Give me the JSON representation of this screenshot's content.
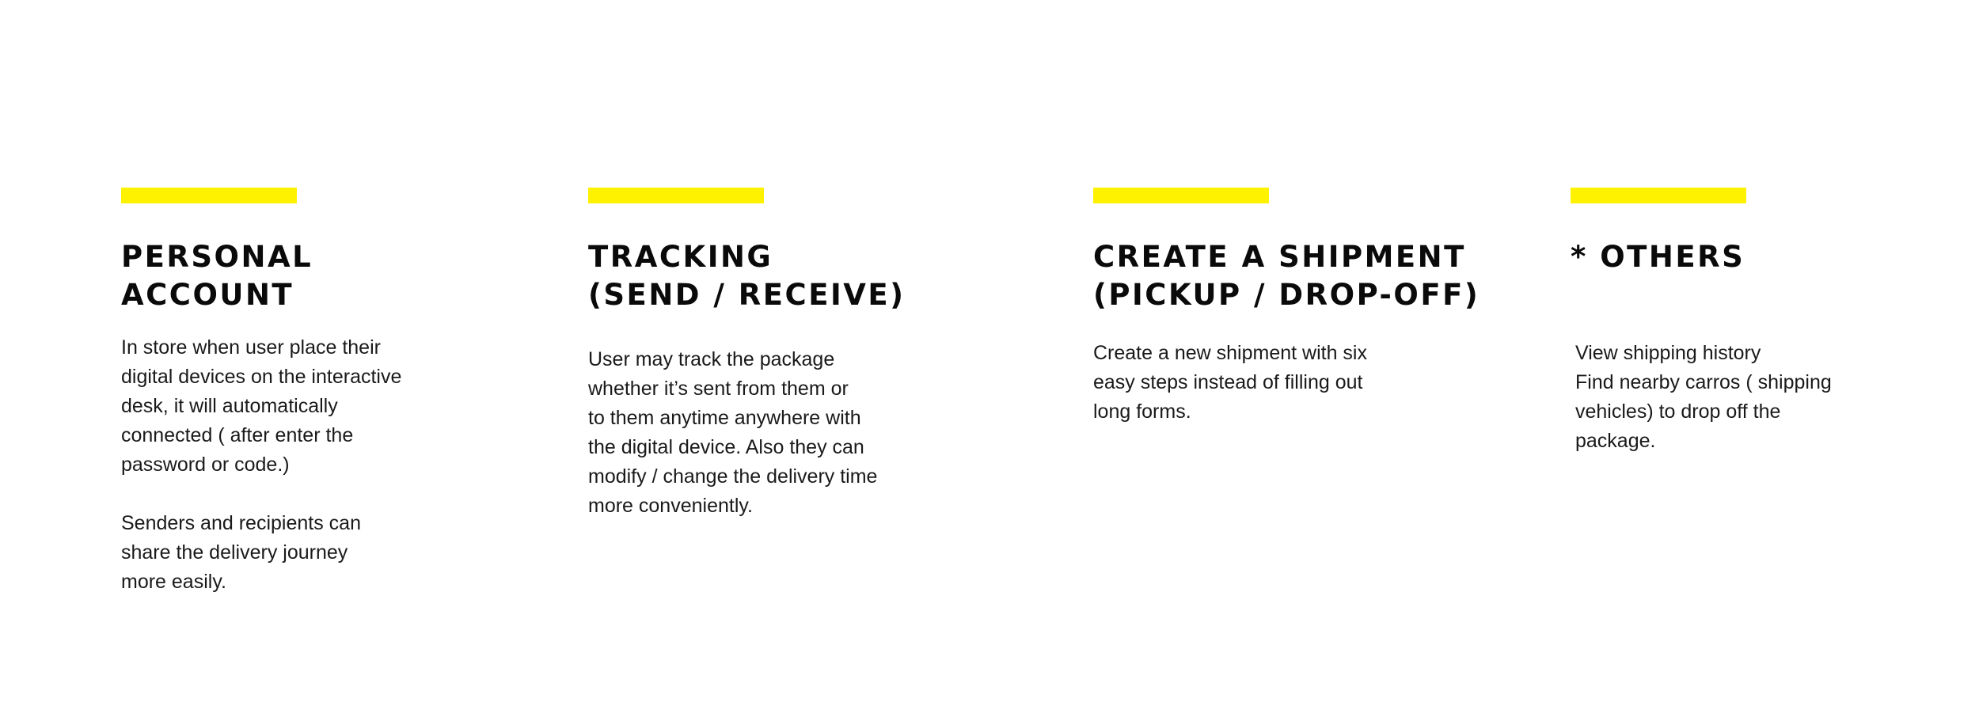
{
  "accent_color": "#FFF200",
  "features": [
    {
      "title": "PERSONAL\nACCOUNT",
      "description": "In store when user place their\ndigital devices on the interactive\ndesk, it will automatically\nconnected ( after enter the\npassword or code.)\n\nSenders and recipients can\nshare the delivery journey\nmore easily."
    },
    {
      "title": "TRACKING\n(SEND / RECEIVE)",
      "description": "User may track the package\nwhether it’s sent from them or\nto them anytime anywhere with\nthe digital device. Also they can\nmodify / change the delivery time\nmore conveniently."
    },
    {
      "title": "CREATE A SHIPMENT\n(PICKUP / DROP-OFF)",
      "description": "Create a new shipment with six\neasy steps instead of filling out\nlong forms."
    },
    {
      "title": "* OTHERS",
      "description": "View shipping history\nFind nearby carros ( shipping\nvehicles) to drop off the\npackage."
    }
  ]
}
